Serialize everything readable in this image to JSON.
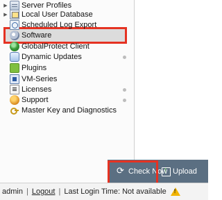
{
  "tree": {
    "items": [
      {
        "label": "Server Profiles",
        "icon": "server-icon",
        "expandable": true
      },
      {
        "label": "Local User Database",
        "icon": "database-icon",
        "expandable": true
      },
      {
        "label": "Scheduled Log Export",
        "icon": "schedule-icon",
        "expandable": false
      },
      {
        "label": "Software",
        "icon": "software-icon",
        "expandable": false,
        "selected": true
      },
      {
        "label": "GlobalProtect Client",
        "icon": "globalprotect-icon",
        "expandable": false
      },
      {
        "label": "Dynamic Updates",
        "icon": "dynamic-updates-icon",
        "expandable": false
      },
      {
        "label": "Plugins",
        "icon": "plugin-icon",
        "expandable": false
      },
      {
        "label": "VM-Series",
        "icon": "vm-series-icon",
        "expandable": false
      },
      {
        "label": "Licenses",
        "icon": "license-icon",
        "expandable": false
      },
      {
        "label": "Support",
        "icon": "support-icon",
        "expandable": false
      },
      {
        "label": "Master Key and Diagnostics",
        "icon": "key-icon",
        "expandable": false
      }
    ]
  },
  "toolbar": {
    "check_now_label": "Check Now",
    "upload_label": "Upload"
  },
  "status_bar": {
    "user": "admin",
    "logout": "Logout",
    "last_login": "Last Login Time: Not available"
  },
  "colors": {
    "highlight": "#e53222",
    "toolbar_bg": "#5b6f82",
    "warning": "#f2b400"
  }
}
